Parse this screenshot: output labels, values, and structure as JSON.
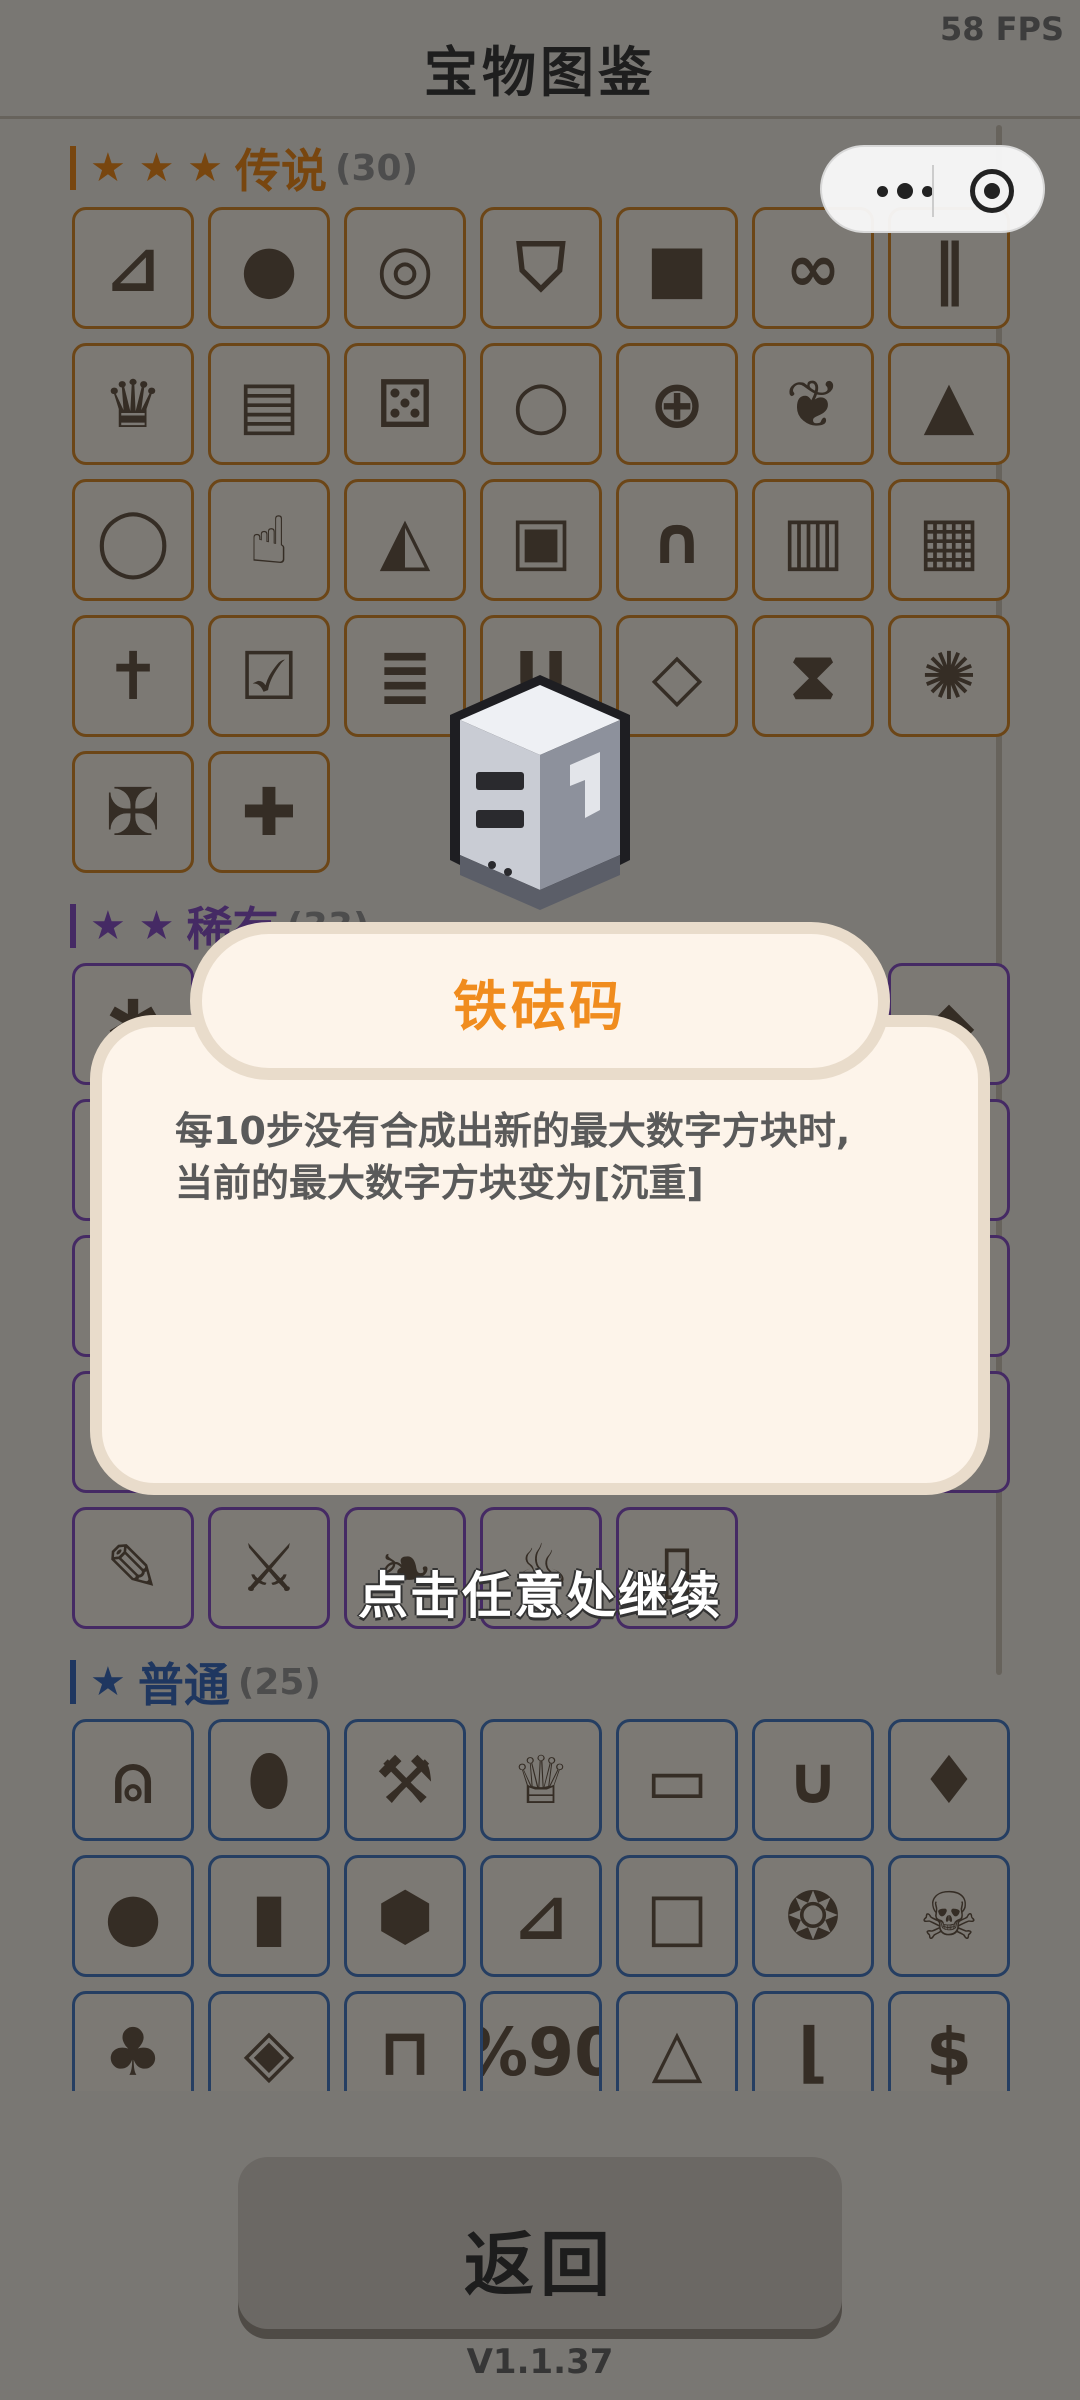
{
  "header": {
    "title": "宝物图鉴",
    "fps": "58 FPS"
  },
  "sections": {
    "legendary": {
      "stars": "★ ★ ★",
      "name": "传说",
      "count": "(30)",
      "color": "#f08c1e",
      "tile_border": "#d98d2f"
    },
    "rare": {
      "stars": "★ ★",
      "name": "稀有",
      "count": "(33)",
      "color": "#8a55c8",
      "tile_border": "#8a55c8"
    },
    "common": {
      "stars": "★",
      "name": "普通",
      "count": "(25)",
      "color": "#3f6fc0",
      "tile_border": "#4a7cc4"
    }
  },
  "legendary_items": [
    {
      "icon": "boot-icon",
      "glyph": "⊿"
    },
    {
      "icon": "crystal-orb-icon",
      "glyph": "●"
    },
    {
      "icon": "compass-dome-icon",
      "glyph": "◎"
    },
    {
      "icon": "magnet-shield-icon",
      "glyph": "⛉"
    },
    {
      "icon": "cube-icon",
      "glyph": "■"
    },
    {
      "icon": "binoculars-icon",
      "glyph": "∞"
    },
    {
      "icon": "dynamite-icon",
      "glyph": "‖"
    },
    {
      "icon": "crown-icon",
      "glyph": "♛"
    },
    {
      "icon": "iron-weight-icon",
      "glyph": "▤"
    },
    {
      "icon": "dice-icon",
      "glyph": "⚄"
    },
    {
      "icon": "ring-icon",
      "glyph": "○"
    },
    {
      "icon": "compass-icon",
      "glyph": "⊕"
    },
    {
      "icon": "leaf-icon",
      "glyph": "❦"
    },
    {
      "icon": "prism-icon",
      "glyph": "▲"
    },
    {
      "icon": "gold-ring-icon",
      "glyph": "◯"
    },
    {
      "icon": "hand-pointer-icon",
      "glyph": "☝"
    },
    {
      "icon": "shell-icon",
      "glyph": "◭"
    },
    {
      "icon": "box-icon",
      "glyph": "▣"
    },
    {
      "icon": "pipe-icon",
      "glyph": "∩"
    },
    {
      "icon": "book-icon",
      "glyph": "▥"
    },
    {
      "icon": "treasure-chest-icon",
      "glyph": "▦"
    },
    {
      "icon": "cross-icon",
      "glyph": "✝"
    },
    {
      "icon": "checklist-icon",
      "glyph": "☑"
    },
    {
      "icon": "receipt-icon",
      "glyph": "≣"
    },
    {
      "icon": "cup-icon",
      "glyph": "U"
    },
    {
      "icon": "diamond-ring-icon",
      "glyph": "◇"
    },
    {
      "icon": "hourglass-icon",
      "glyph": "⧗"
    },
    {
      "icon": "phoenix-coin-icon",
      "glyph": "✺"
    },
    {
      "icon": "cross-coin-icon",
      "glyph": "✠"
    },
    {
      "icon": "bible-icon",
      "glyph": "✚"
    }
  ],
  "rare_items": [
    {
      "icon": "ice-crown-icon",
      "glyph": "✱"
    },
    {
      "icon": "crystal-icon",
      "glyph": "◆"
    },
    {
      "icon": "rare-item-icon",
      "glyph": "◧"
    },
    {
      "icon": "rare-item-icon",
      "glyph": "◨"
    },
    {
      "icon": "rare-item-icon",
      "glyph": "◧"
    },
    {
      "icon": "rare-item-icon",
      "glyph": "◨"
    },
    {
      "icon": "rare-item-icon",
      "glyph": "◧"
    },
    {
      "icon": "rare-item-icon",
      "glyph": "◨"
    },
    {
      "icon": "pen-icon",
      "glyph": "✎"
    },
    {
      "icon": "swords-coin-icon",
      "glyph": "⚔"
    },
    {
      "icon": "scroll-icon",
      "glyph": "❧"
    },
    {
      "icon": "fire-coin-icon",
      "glyph": "♨"
    },
    {
      "icon": "paper-roll-icon",
      "glyph": "▯"
    }
  ],
  "common_items": [
    {
      "icon": "bell-icon",
      "glyph": "⍝"
    },
    {
      "icon": "eggplant-icon",
      "glyph": "⬮"
    },
    {
      "icon": "hammer-icon",
      "glyph": "⚒"
    },
    {
      "icon": "purple-crown-icon",
      "glyph": "♕"
    },
    {
      "icon": "battery-icon",
      "glyph": "▭"
    },
    {
      "icon": "horseshoe-magnet-icon",
      "glyph": "∪"
    },
    {
      "icon": "fire-anvil-icon",
      "glyph": "♦"
    },
    {
      "icon": "pepper-icon",
      "glyph": "●"
    },
    {
      "icon": "bucket-icon",
      "glyph": "▮"
    },
    {
      "icon": "coal-icon",
      "glyph": "⬢"
    },
    {
      "icon": "brown-boot-icon",
      "glyph": "⊿"
    },
    {
      "icon": "ice-cube-icon",
      "glyph": "□"
    },
    {
      "icon": "seal-icon",
      "glyph": "❂"
    },
    {
      "icon": "skull-shield-icon",
      "glyph": "☠"
    },
    {
      "icon": "money-bag-icon",
      "glyph": "♣"
    },
    {
      "icon": "gem-coin-icon",
      "glyph": "◈"
    },
    {
      "icon": "open-book-icon",
      "glyph": "⊓"
    },
    {
      "icon": "discount-ticket-icon",
      "glyph": "%90"
    },
    {
      "icon": "pyramid-eye-icon",
      "glyph": "△"
    },
    {
      "icon": "sneaker-icon",
      "glyph": "⌊"
    },
    {
      "icon": "dollar-coin-icon",
      "glyph": "$"
    }
  ],
  "modal": {
    "item_name": "铁砝码",
    "description_line1": "每10步没有合成出新的最大数字方块时,",
    "description_line2": "当前的最大数字方块变为[沉重]",
    "continue_hint": "点击任意处继续",
    "item_icon": "iron-weight-icon"
  },
  "footer": {
    "back_label": "返回",
    "version": "V1.1.37"
  },
  "colors": {
    "title_orange": "#f08c1e",
    "background": "#f3eee6",
    "modal_bg": "#fdf4ea"
  }
}
